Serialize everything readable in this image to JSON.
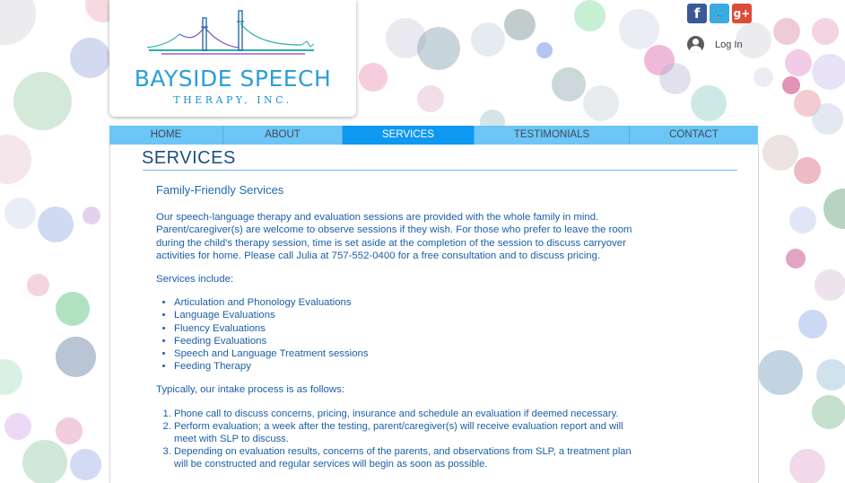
{
  "logo": {
    "title": "BAYSIDE SPEECH",
    "subtitle": "THERAPY, INC."
  },
  "social": {
    "facebook": "f",
    "twitter": "t",
    "googleplus": "g+"
  },
  "login": {
    "label": "Log In"
  },
  "nav": {
    "items": [
      {
        "label": "HOME"
      },
      {
        "label": "ABOUT"
      },
      {
        "label": "SERVICES"
      },
      {
        "label": "TESTIMONIALS"
      },
      {
        "label": "CONTACT"
      }
    ],
    "active_index": 2
  },
  "page": {
    "title": "SERVICES",
    "heading": "Family-Friendly Services",
    "intro": "Our speech-language therapy and evaluation sessions are provided with the whole family in mind. Parent/caregiver(s) are welcome to observe sessions if they wish. For those who prefer to leave the room during the child's therapy session, time is set aside at the completion of the session to discuss carryover activities for home. Please call Julia at 757-552-0400 for a free consultation and to discuss pricing.",
    "services_label": "Services include:",
    "services": [
      "Articulation and Phonology Evaluations",
      "Language Evaluations",
      "Fluency Evaluations",
      "Feeding Evaluations",
      "Speech and Language Treatment sessions",
      "Feeding Therapy"
    ],
    "process_label": "Typically, our intake process is as follows:",
    "process": [
      "Phone call to discuss concerns, pricing, insurance and schedule an evaluation if deemed necessary.",
      "Perform evaluation; a week after the testing, parent/caregiver(s) will receive evaluation report and will meet with SLP to discuss.",
      "Depending on evaluation results, concerns of the parents, and observations from SLP, a treatment plan will be constructed and regular services will begin as soon as possible."
    ]
  },
  "colors": {
    "nav_bg": "#6cc5f7",
    "nav_active": "#0e98f0",
    "title": "#1c4e82",
    "body_text": "#1b5fa6",
    "logo": "#2a9fd8"
  }
}
